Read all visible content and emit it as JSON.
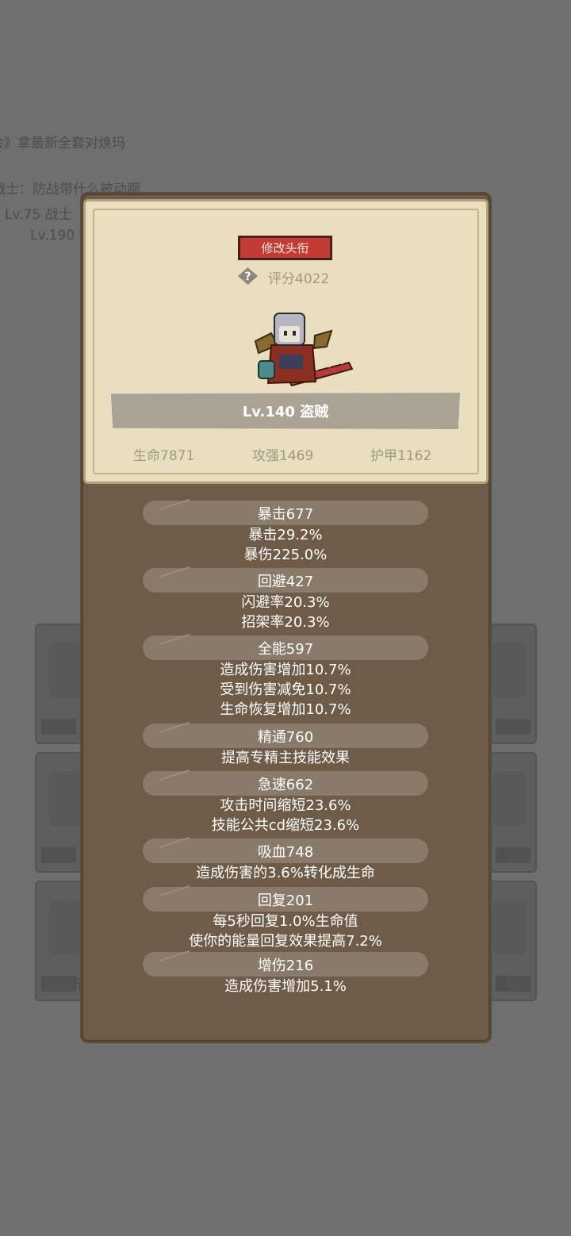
{
  "background": {
    "chat_line_1": "会》拿最新全套对焕玛",
    "chat_line_2": "战士：防战带什么被动啊",
    "chat_line_3": "Lv.75 战士",
    "chat_line_4": "Lv.190",
    "card_glyph_left": "描",
    "card_glyph_right_1": "人",
    "card_glyph_right_2": "品"
  },
  "profile": {
    "change_title_label": "修改头衔",
    "help_icon": "question-diamond-icon",
    "score_text": "评分4022",
    "level_class": "Lv.140 盗贼",
    "stats": {
      "life": "生命7871",
      "attack": "攻强1469",
      "armor": "护甲1162"
    }
  },
  "attributes": [
    {
      "header": "暴击677",
      "lines": [
        "暴击29.2%",
        "暴伤225.0%"
      ]
    },
    {
      "header": "回避427",
      "lines": [
        "闪避率20.3%",
        "招架率20.3%"
      ]
    },
    {
      "header": "全能597",
      "lines": [
        "造成伤害增加10.7%",
        "受到伤害减免10.7%",
        "生命恢复增加10.7%"
      ]
    },
    {
      "header": "精通760",
      "lines": [
        "提高专精主技能效果"
      ]
    },
    {
      "header": "急速662",
      "lines": [
        "攻击时间缩短23.6%",
        "技能公共cd缩短23.6%"
      ]
    },
    {
      "header": "吸血748",
      "lines": [
        "造成伤害的3.6%转化成生命"
      ]
    },
    {
      "header": "回复201",
      "lines": [
        "每5秒回复1.0%生命值",
        "使你的能量回复效果提高7.2%"
      ]
    },
    {
      "header": "增伤216",
      "lines": [
        "造成伤害增加5.1%"
      ]
    }
  ],
  "colors": {
    "overlay": "#6f6f6f",
    "panel": "#6e5c48",
    "parchment": "#e9dfbf",
    "title_button": "#c43a34",
    "section_bar": "#8a7a6a"
  }
}
